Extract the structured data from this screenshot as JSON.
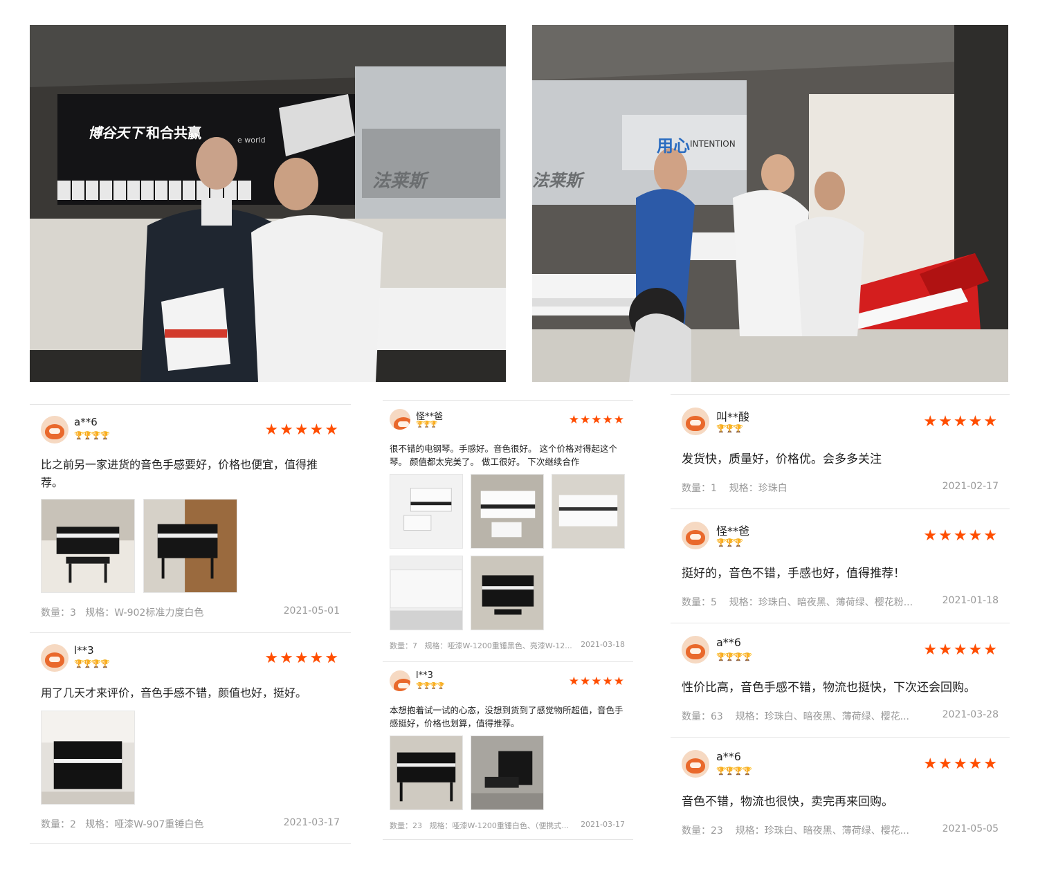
{
  "photos": {
    "left": {
      "banner_text": "博谷天下",
      "banner_text2": "和合共赢",
      "banner_sub": "e world",
      "logo_text": "法莱斯"
    },
    "right": {
      "banner_text": "用心",
      "banner_sub": "INTENTION",
      "logo_text": "法莱斯"
    }
  },
  "colors": {
    "star": "#ff4d00",
    "meta": "#999999",
    "divider": "#e4e4e4"
  },
  "col1": {
    "reviews": [
      {
        "user": "a**6",
        "badge": "🏆🏆🏆🏆",
        "stars": "★★★★★",
        "text": "比之前另一家进货的音色手感要好，价格也便宜，值得推荐。",
        "qty_label": "数量：3",
        "spec_label": "规格：W-902标准力度白色",
        "date": "2021-05-01",
        "thumbs": [
          "piano-black-bench",
          "piano-black-wood"
        ]
      },
      {
        "user": "l**3",
        "badge": "🏆🏆🏆🏆",
        "stars": "★★★★★",
        "text": "用了几天才来评价，音色手感不错，颜值也好，挺好。",
        "qty_label": "数量：2",
        "spec_label": "规格：哑漆W-907重锤白色",
        "date": "2021-03-17",
        "thumbs": [
          "piano-upright"
        ]
      }
    ]
  },
  "col2": {
    "reviews": [
      {
        "user": "怪**爸",
        "badge": "🏆🏆🏆",
        "stars": "★★★★★",
        "text": "很不错的电钢琴。手感好。音色很好。 这个价格对得起这个琴。 颜值都太完美了。 做工很好。 下次继续合作",
        "qty_label": "数量：7",
        "spec_label": "规格：哑漆W-1200重锤黑色、亮漆W-12...",
        "date": "2021-03-18",
        "thumbs": [
          "piano-white-open",
          "piano-white-keys",
          "piano-white-side",
          "piano-white-closed",
          "piano-black-room"
        ]
      },
      {
        "user": "l**3",
        "badge": "🏆🏆🏆🏆",
        "stars": "★★★★★",
        "text": "本想抱着试一试的心态，没想到货到了感觉物所超值，音色手感挺好，价格也划算，值得推荐。",
        "qty_label": "数量：23",
        "spec_label": "规格：哑漆W-1200重锤白色、（便携式...",
        "date": "2021-03-17",
        "thumbs": [
          "piano-black-front",
          "piano-black-angle"
        ]
      }
    ]
  },
  "col3": {
    "reviews": [
      {
        "user": "叫**酸",
        "badge": "🏆🏆🏆",
        "stars": "★★★★★",
        "text": "发货快，质量好，价格优。会多多关注",
        "qty_label": "数量：1",
        "spec_label": "规格：珍珠白",
        "date": "2021-02-17"
      },
      {
        "user": "怪**爸",
        "badge": "🏆🏆🏆",
        "stars": "★★★★★",
        "text": "挺好的，音色不错，手感也好，值得推荐！",
        "qty_label": "数量：5",
        "spec_label": "规格：珍珠白、暗夜黑、薄荷绿、樱花粉...",
        "date": "2021-01-18"
      },
      {
        "user": "a**6",
        "badge": "🏆🏆🏆🏆",
        "stars": "★★★★★",
        "text": "性价比高，音色手感不错，物流也挺快，下次还会回购。",
        "qty_label": "数量：63",
        "spec_label": "规格：珍珠白、暗夜黑、薄荷绿、樱花...",
        "date": "2021-03-28"
      },
      {
        "user": "a**6",
        "badge": "🏆🏆🏆🏆",
        "stars": "★★★★★",
        "text": "音色不错，物流也很快，卖完再来回购。",
        "qty_label": "数量：23",
        "spec_label": "规格：珍珠白、暗夜黑、薄荷绿、樱花...",
        "date": "2021-05-05"
      }
    ]
  }
}
